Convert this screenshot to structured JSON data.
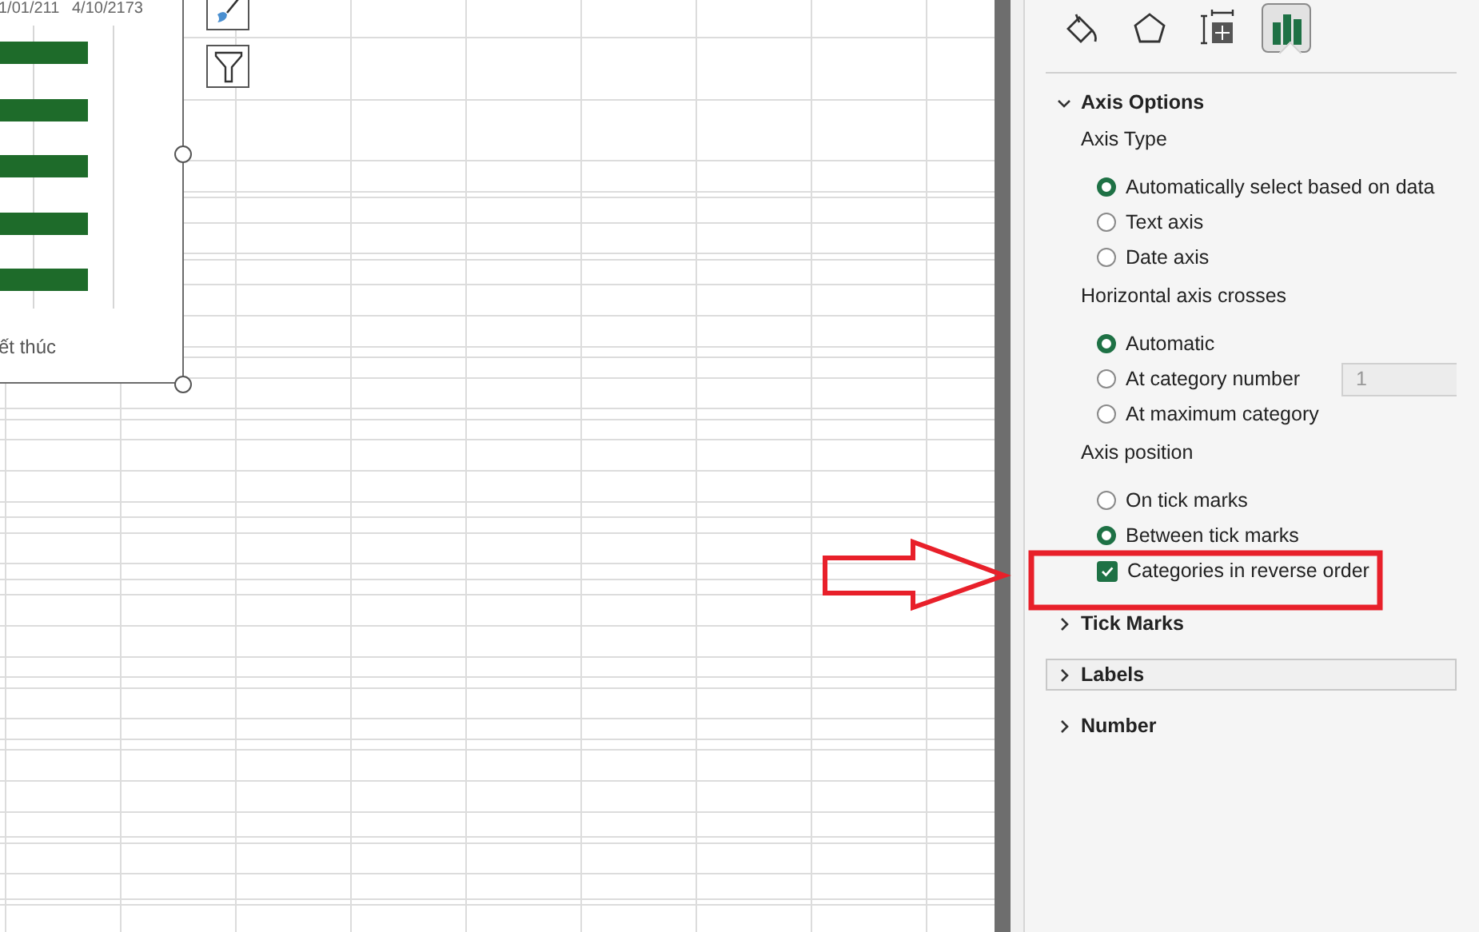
{
  "chart": {
    "axis_labels": [
      "1/01/211",
      "4/10/2173"
    ],
    "legend_text": "ết thúc"
  },
  "pane": {
    "tabs": [
      {
        "kind": "fill",
        "selected": false
      },
      {
        "kind": "effects",
        "selected": false
      },
      {
        "kind": "size",
        "selected": false
      },
      {
        "kind": "axis",
        "selected": true
      }
    ],
    "sections": [
      {
        "title": "Axis Options",
        "expanded": true,
        "focused": false,
        "groups": [
          {
            "label": "Axis Type",
            "options": [
              {
                "kind": "radio",
                "label": "Automatically select based on data",
                "selected": true
              },
              {
                "kind": "radio",
                "label": "Text axis",
                "selected": false
              },
              {
                "kind": "radio",
                "label": "Date axis",
                "selected": false
              }
            ]
          },
          {
            "label": "Horizontal axis crosses",
            "options": [
              {
                "kind": "radio",
                "label": "Automatic",
                "selected": true
              },
              {
                "kind": "radio",
                "label": "At category number",
                "selected": false,
                "field": {
                  "value": "1",
                  "disabled": true
                }
              },
              {
                "kind": "radio",
                "label": "At maximum category",
                "selected": false
              }
            ]
          },
          {
            "label": "Axis position",
            "options": [
              {
                "kind": "radio",
                "label": "On tick marks",
                "selected": false
              },
              {
                "kind": "radio",
                "label": "Between tick marks",
                "selected": true
              },
              {
                "kind": "checkbox",
                "label": "Categories in reverse order",
                "checked": true
              }
            ]
          }
        ]
      },
      {
        "title": "Tick Marks",
        "expanded": false,
        "focused": false
      },
      {
        "title": "Labels",
        "expanded": false,
        "focused": true
      },
      {
        "title": "Number",
        "expanded": false,
        "focused": false
      }
    ]
  }
}
